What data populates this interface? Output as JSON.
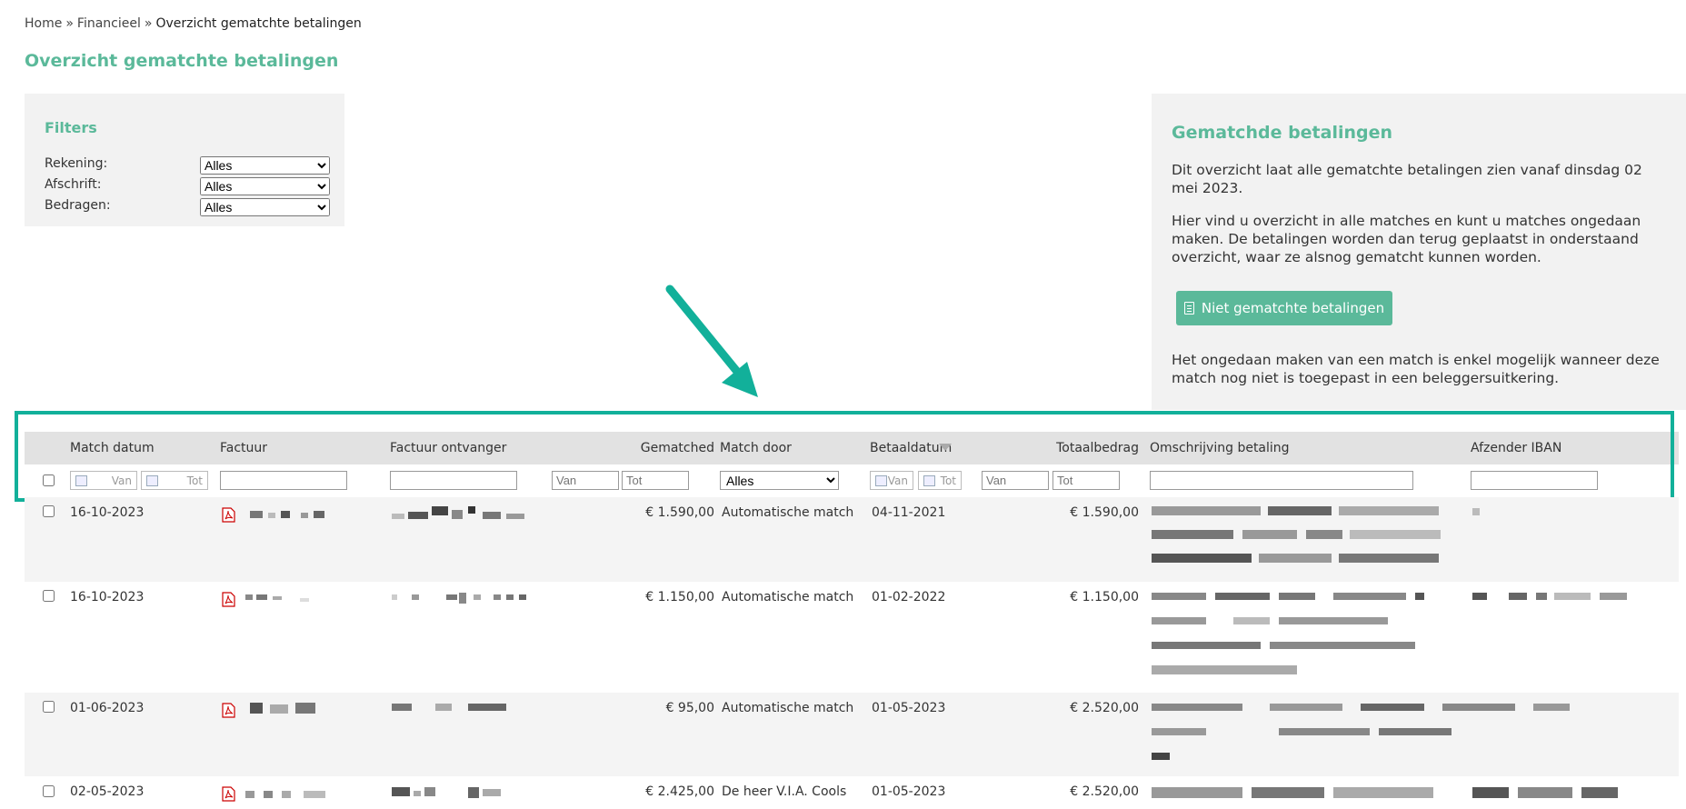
{
  "breadcrumb": {
    "home": "Home",
    "separator": "»",
    "section": "Financieel",
    "current": "Overzicht gematchte betalingen"
  },
  "page_title": "Overzicht gematchte betalingen",
  "filters": {
    "title": "Filters",
    "rekening_label": "Rekening:",
    "rekening_value": "Alles",
    "afschrift_label": "Afschrift:",
    "afschrift_value": "Alles",
    "bedragen_label": "Bedragen:",
    "bedragen_value": "Alles"
  },
  "info": {
    "title": "Gematchde betalingen",
    "p1": "Dit overzicht laat alle gematchte betalingen zien vanaf dinsdag 02 mei 2023.",
    "p2": "Hier vind u overzicht in alle matches en kunt u matches ongedaan maken. De betalingen worden dan terug geplaatst in onderstaand overzicht, waar ze alsnog gematcht kunnen worden.",
    "button_label": "Niet gematchte betalingen",
    "p3": "Het ongedaan maken van een match is enkel mogelijk wanneer deze match nog niet is toegepast in een beleggersuitkering."
  },
  "table": {
    "headers": {
      "match_datum": "Match datum",
      "factuur": "Factuur",
      "factuur_ontvanger": "Factuur ontvanger",
      "gematched": "Gematched",
      "match_door": "Match door",
      "betaaldatum": "Betaaldatum",
      "totaalbedrag": "Totaalbedrag",
      "omschrijving": "Omschrijving betaling",
      "afzender_iban": "Afzender IBAN"
    },
    "filter": {
      "van": "Van",
      "tot": "Tot",
      "match_door_value": "Alles"
    },
    "rows": [
      {
        "match_datum": "16-10-2023",
        "gematched": "€ 1.590,00",
        "match_door": "Automatische match",
        "betaaldatum": "04-11-2021",
        "totaalbedrag": "€ 1.590,00"
      },
      {
        "match_datum": "16-10-2023",
        "gematched": "€ 1.150,00",
        "match_door": "Automatische match",
        "betaaldatum": "01-02-2022",
        "totaalbedrag": "€ 1.150,00"
      },
      {
        "match_datum": "01-06-2023",
        "gematched": "€ 95,00",
        "match_door": "Automatische match",
        "betaaldatum": "01-05-2023",
        "totaalbedrag": "€ 2.520,00"
      },
      {
        "match_datum": "02-05-2023",
        "gematched": "€ 2.425,00",
        "match_door": "De heer V.I.A. Cools",
        "betaaldatum": "01-05-2023",
        "totaalbedrag": "€ 2.520,00"
      }
    ]
  },
  "colors": {
    "accent": "#5bb99a",
    "highlight": "#12b09a",
    "panel": "#f2f2f2",
    "header": "#e2e2e2"
  },
  "icons": [
    "document-icon",
    "calendar-icon",
    "pdf-icon",
    "sort-desc-icon",
    "arrow-annotation"
  ]
}
